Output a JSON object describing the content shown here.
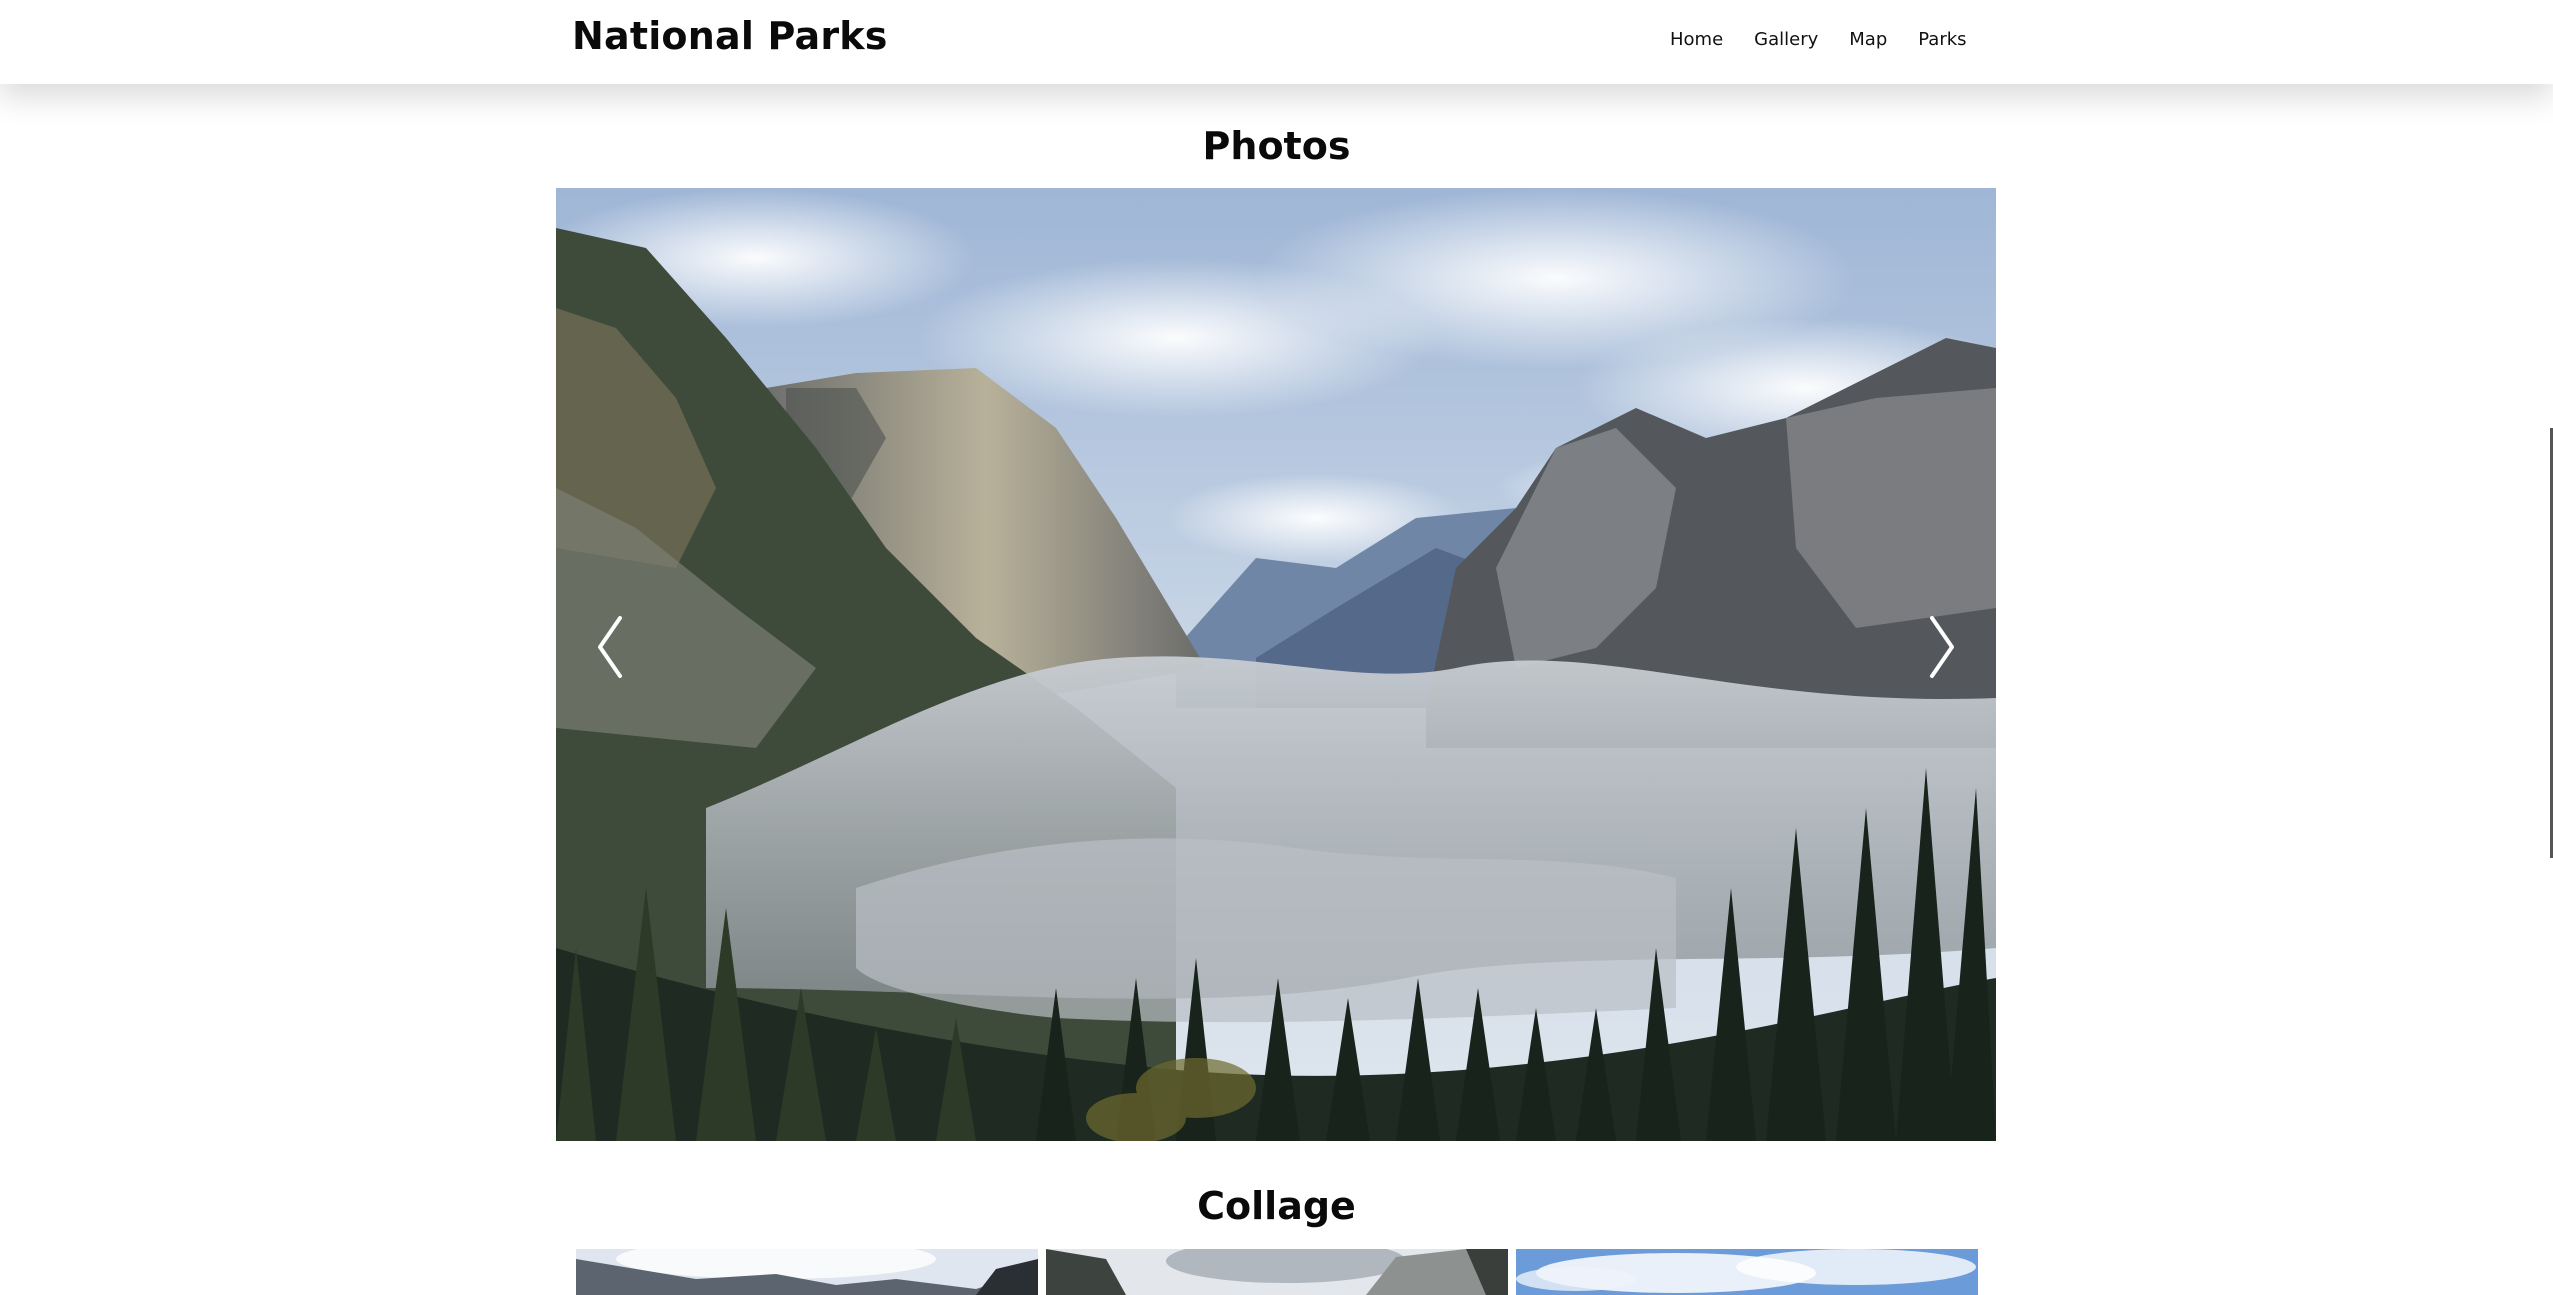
{
  "header": {
    "title": "National Parks",
    "nav": [
      "Home",
      "Gallery",
      "Map",
      "Parks"
    ]
  },
  "sections": {
    "photos_title": "Photos",
    "collage_title": "Collage"
  },
  "carousel": {
    "prev_icon": "chevron-left-icon",
    "next_icon": "chevron-right-icon"
  },
  "colors": {
    "background": "#ffffff",
    "text": "#111111"
  }
}
